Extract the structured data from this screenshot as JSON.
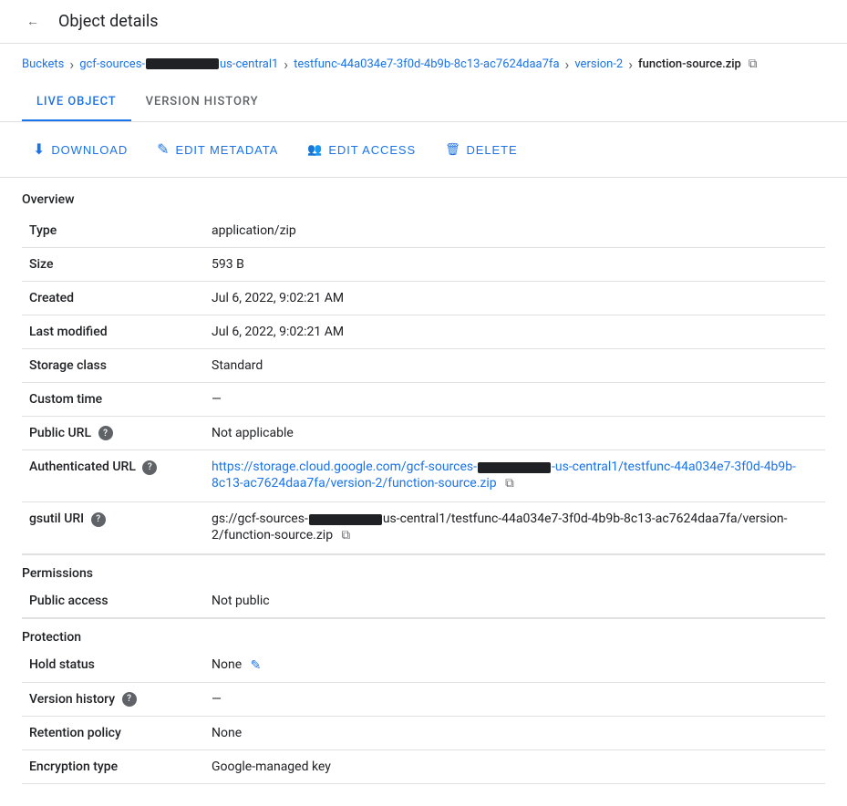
{
  "header": {
    "back_label": "←",
    "title": "Object details"
  },
  "breadcrumb": {
    "items": [
      {
        "label": "Buckets",
        "link": true
      },
      {
        "label": "gcf-sources-",
        "redacted": true,
        "suffix": "us-central1",
        "link": true
      },
      {
        "label": "testfunc-44a034e7-3f0d-4b9b-8c13-ac7624daa7fa",
        "link": true
      },
      {
        "label": "version-2",
        "link": true
      },
      {
        "label": "function-source.zip",
        "link": false,
        "current": true
      }
    ]
  },
  "tabs": [
    {
      "label": "LIVE OBJECT",
      "active": true
    },
    {
      "label": "VERSION HISTORY",
      "active": false
    }
  ],
  "toolbar": {
    "buttons": [
      {
        "key": "download",
        "label": "DOWNLOAD",
        "icon": "⬇"
      },
      {
        "key": "edit-metadata",
        "label": "EDIT METADATA",
        "icon": "✎"
      },
      {
        "key": "edit-access",
        "label": "EDIT ACCESS",
        "icon": "👥"
      },
      {
        "key": "delete",
        "label": "DELETE",
        "icon": "🗑"
      }
    ]
  },
  "overview": {
    "section_label": "Overview",
    "rows": [
      {
        "key": "type",
        "label": "Type",
        "value": "application/zip",
        "help": false
      },
      {
        "key": "size",
        "label": "Size",
        "value": "593 B",
        "help": false
      },
      {
        "key": "created",
        "label": "Created",
        "value": "Jul 6, 2022, 9:02:21 AM",
        "help": false
      },
      {
        "key": "last-modified",
        "label": "Last modified",
        "value": "Jul 6, 2022, 9:02:21 AM",
        "help": false
      },
      {
        "key": "storage-class",
        "label": "Storage class",
        "value": "Standard",
        "help": false
      },
      {
        "key": "custom-time",
        "label": "Custom time",
        "value": "—",
        "help": false
      },
      {
        "key": "public-url",
        "label": "Public URL",
        "value": "Not applicable",
        "help": true
      },
      {
        "key": "authenticated-url",
        "label": "Authenticated URL",
        "value": "",
        "help": true,
        "link": true,
        "link_prefix": "https://storage.cloud.google.com/gcf-sources-",
        "link_suffix": "-us-central1/testfunc-44a034e7-3f0d-4b9b-8c13-ac7624daa7fa/version-2/function-source.zip",
        "copy": true
      },
      {
        "key": "gsutil-uri",
        "label": "gsutil URI",
        "value": "",
        "help": true,
        "gsutil": true,
        "gsutil_prefix": "gs://gcf-sources-",
        "gsutil_suffix": "us-central1/testfunc-44a034e7-3f0d-4b9b-8c13-ac7624daa7fa/version-2/function-source.zip",
        "copy": true
      }
    ]
  },
  "permissions": {
    "section_label": "Permissions",
    "rows": [
      {
        "key": "public-access",
        "label": "Public access",
        "value": "Not public",
        "help": false
      }
    ]
  },
  "protection": {
    "section_label": "Protection",
    "rows": [
      {
        "key": "hold-status",
        "label": "Hold status",
        "value": "None",
        "edit": true,
        "help": false
      },
      {
        "key": "version-history",
        "label": "Version history",
        "value": "—",
        "help": true
      },
      {
        "key": "retention-policy",
        "label": "Retention policy",
        "value": "None",
        "help": false
      },
      {
        "key": "encryption-type",
        "label": "Encryption type",
        "value": "Google-managed key",
        "help": false
      }
    ]
  },
  "icons": {
    "back": "←",
    "chevron_right": "›",
    "copy": "⧉",
    "help": "?",
    "edit": "✎",
    "download": "⬇",
    "edit_metadata": "✎",
    "edit_access": "👥",
    "delete": "🗑"
  }
}
